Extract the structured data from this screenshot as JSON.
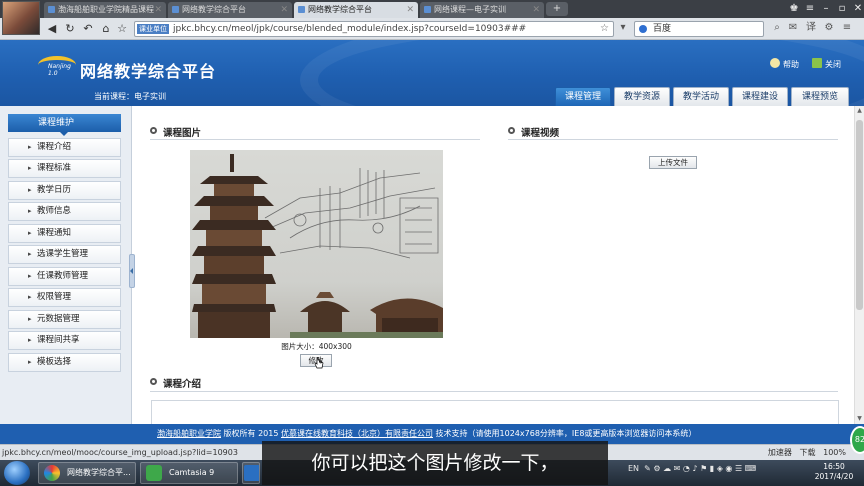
{
  "browser": {
    "tabs": [
      {
        "label": "渤海船舶职业学院精品课程",
        "active": false
      },
      {
        "label": "网络教学综合平台",
        "active": false
      },
      {
        "label": "网络教学综合平台",
        "active": true
      },
      {
        "label": "网络课程—电子实训",
        "active": false
      }
    ],
    "url": "jpkc.bhcy.cn/meol/jpk/course/blended_module/index.jsp?courseId=10903###",
    "url_badge": "课业单位",
    "search_text": "百度",
    "new_tab": "+"
  },
  "site": {
    "logo_text": "Nanjing 1.0",
    "title": "网络教学综合平台",
    "current_course": "当前课程：电子实训",
    "help": "帮助",
    "close": "关闭",
    "nav_tabs": [
      "课程管理",
      "教学资源",
      "教学活动",
      "课程建设",
      "课程预览"
    ]
  },
  "sidebar": {
    "header": "课程维护",
    "items": [
      "课程介绍",
      "课程标准",
      "教学日历",
      "教师信息",
      "课程通知",
      "选课学生管理",
      "任课教师管理",
      "权限管理",
      "元数据管理",
      "课程间共享",
      "模板选择"
    ]
  },
  "content": {
    "pic_section": "课程图片",
    "video_section": "课程视频",
    "intro_section": "课程介绍",
    "pic_caption": "图片大小：400x300",
    "modify_button": "修改",
    "upload_button": "上传文件"
  },
  "footer": {
    "school": "渤海船舶职业学院",
    "rights": " 版权所有 2015 ",
    "company": "优慕课在线教育科技（北京）有限责任公司",
    "support": " 技术支持（请使用1024x768分辨率，IE8或更高版本浏览器访问本系统）"
  },
  "status": {
    "url": "jpkc.bhcy.cn/meol/mooc/course_img_upload.jsp?lid=10903",
    "accelerator": "加速器",
    "download": "下载",
    "zoom": "100%",
    "green_button": "82"
  },
  "taskbar": {
    "items": [
      {
        "label": "网络教学综合平..."
      },
      {
        "label": "Camtasia 9"
      }
    ],
    "ime": "EN",
    "time": "16:50",
    "date": "2017/4/20"
  },
  "subtitle": "你可以把这个图片修改一下，",
  "colors": {
    "header_blue": "#1f5fb0",
    "tab_active": "#2a78c9",
    "sidebar_bg": "#e8edf3"
  }
}
